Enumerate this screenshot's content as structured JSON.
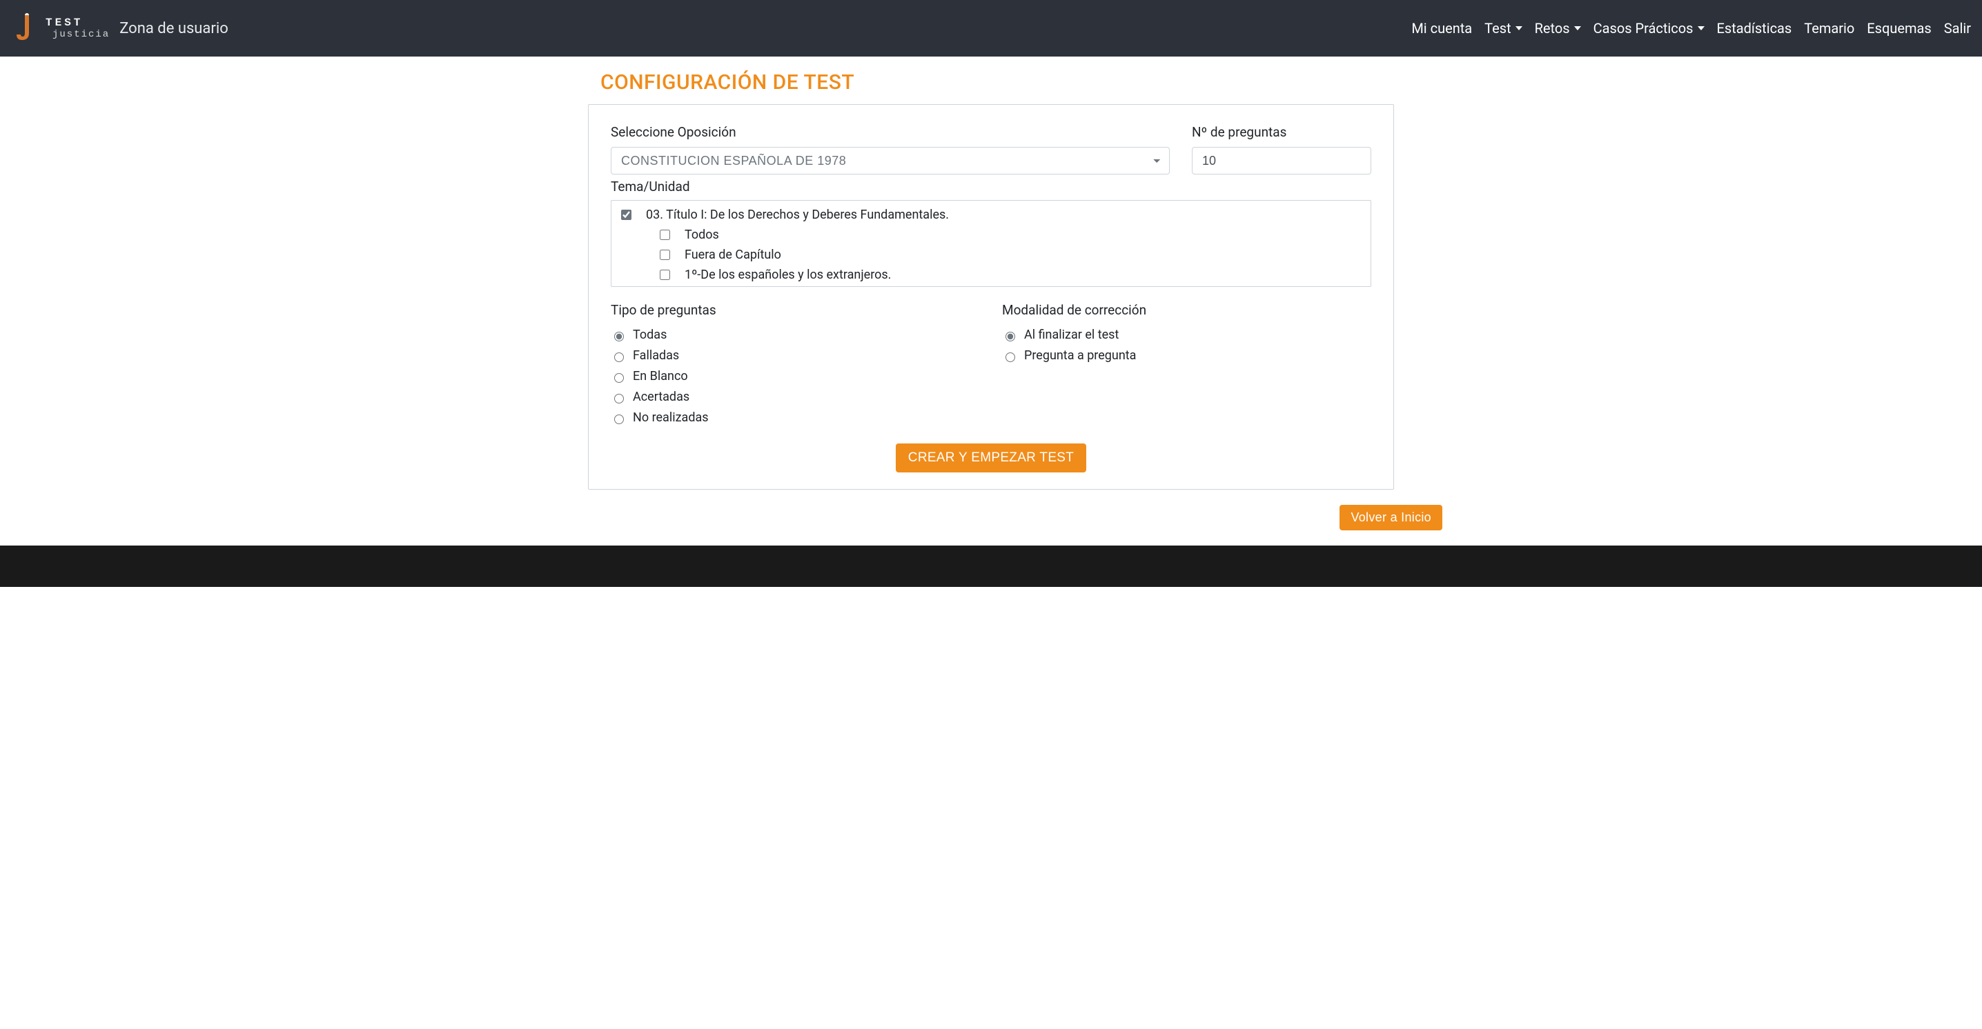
{
  "brand": {
    "logo_top": "TEST",
    "logo_bottom": "justicia",
    "sub": "Zona de usuario"
  },
  "nav": {
    "mi_cuenta": "Mi cuenta",
    "test": "Test",
    "retos": "Retos",
    "casos": "Casos Prácticos",
    "estadisticas": "Estadísticas",
    "temario": "Temario",
    "esquemas": "Esquemas",
    "salir": "Salir"
  },
  "page": {
    "title": "CONFIGURACIÓN DE TEST"
  },
  "form": {
    "oposicion_label": "Seleccione Oposición",
    "oposicion_value": "CONSTITUCION ESPAÑOLA DE 1978",
    "npreguntas_label": "Nº de preguntas",
    "npreguntas_value": "10",
    "tema_label": "Tema/Unidad",
    "tree": [
      {
        "level": 0,
        "checked": true,
        "label": "03. Título I: De los Derechos y Deberes Fundamentales."
      },
      {
        "level": 1,
        "checked": false,
        "label": "Todos"
      },
      {
        "level": 1,
        "checked": false,
        "label": "Fuera de Capítulo"
      },
      {
        "level": 1,
        "checked": false,
        "label": "1º-De los españoles y los extranjeros."
      }
    ],
    "tipo_label": "Tipo de preguntas",
    "tipo_options": [
      {
        "label": "Todas",
        "checked": true
      },
      {
        "label": "Falladas",
        "checked": false
      },
      {
        "label": "En Blanco",
        "checked": false
      },
      {
        "label": "Acertadas",
        "checked": false
      },
      {
        "label": "No realizadas",
        "checked": false
      }
    ],
    "modalidad_label": "Modalidad de corrección",
    "modalidad_options": [
      {
        "label": "Al finalizar el test",
        "checked": true
      },
      {
        "label": "Pregunta a pregunta",
        "checked": false
      }
    ],
    "submit_label": "CREAR Y EMPEZAR TEST"
  },
  "footer": {
    "back_label": "Volver a Inicio"
  }
}
